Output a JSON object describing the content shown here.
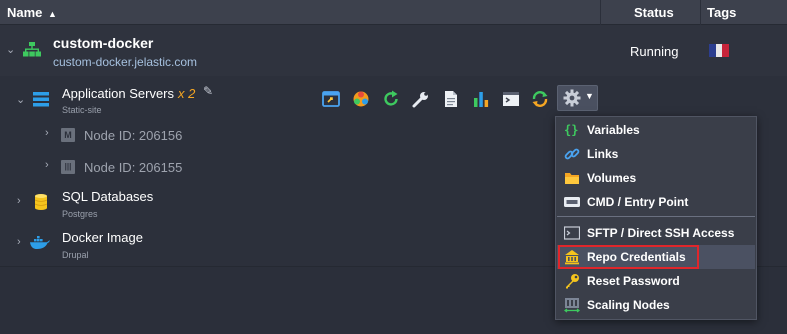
{
  "header": {
    "name_label": "Name",
    "status_label": "Status",
    "tags_label": "Tags"
  },
  "environment": {
    "name": "custom-docker",
    "domain": "custom-docker.jelastic.com",
    "status": "Running"
  },
  "groups": [
    {
      "title": "Application Servers",
      "multiplier": "x 2",
      "subtitle": "Static-site"
    },
    {
      "title": "SQL Databases",
      "subtitle": "Postgres"
    },
    {
      "title": "Docker Image",
      "subtitle": "Drupal"
    }
  ],
  "nodes": [
    {
      "badge": "M",
      "label": "Node ID: 206156"
    },
    {
      "badge": "|||",
      "label": "Node ID: 206155"
    }
  ],
  "icons": {
    "env": "topology-icon",
    "app_servers": "server-stack-icon",
    "database": "database-icon",
    "docker": "docker-whale-icon"
  },
  "toolbar": [
    "open-in-browser-icon",
    "addons-icon",
    "restart-icon",
    "config-wrench-icon",
    "log-file-icon",
    "statistics-icon",
    "web-ssh-icon",
    "redeploy-icon",
    "gear-icon"
  ],
  "menu": {
    "items_top": [
      "Variables",
      "Links",
      "Volumes",
      "CMD / Entry Point"
    ],
    "items_bottom": [
      "SFTP / Direct SSH Access",
      "Repo Credentials",
      "Reset Password",
      "Scaling Nodes"
    ],
    "highlighted": "Repo Credentials"
  },
  "colors": {
    "background": "#2b2f3a",
    "header": "#3d414d",
    "accent_orange": "#f5a623",
    "accent_blue": "#2d9ee8",
    "highlight_red": "#e0262b"
  }
}
